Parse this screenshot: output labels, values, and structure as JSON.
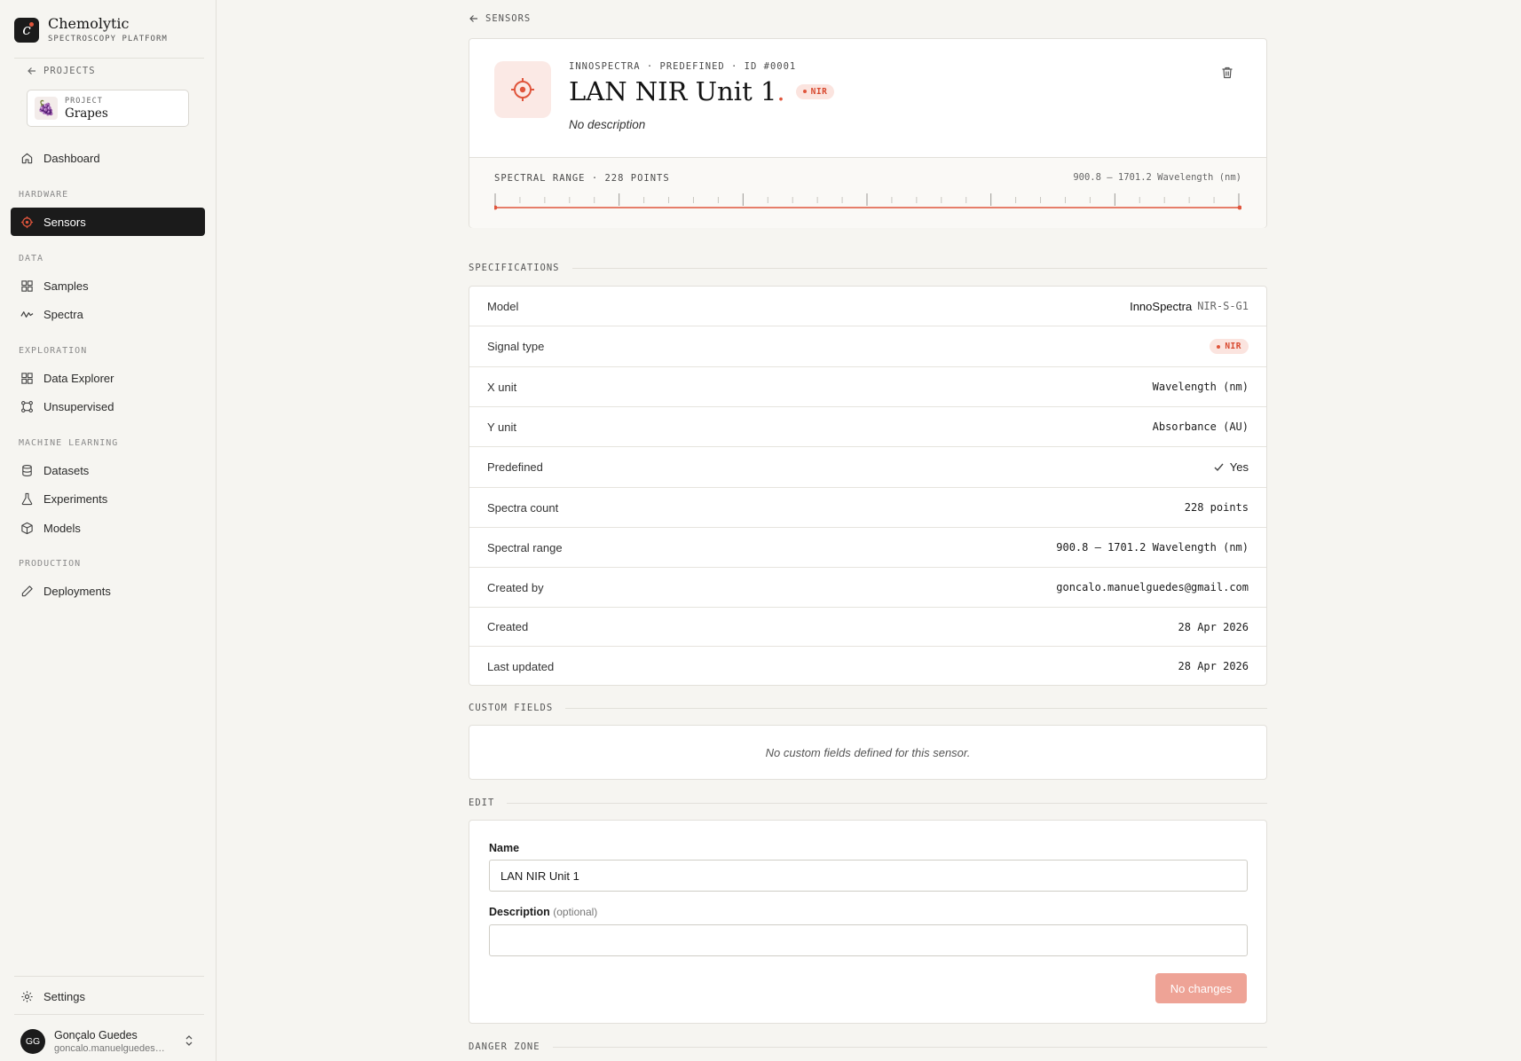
{
  "brand": {
    "name": "Chemolytic",
    "subtitle": "SPECTROSCOPY PLATFORM"
  },
  "sidebar": {
    "back_label": "PROJECTS",
    "project": {
      "label": "PROJECT",
      "name": "Grapes",
      "thumb": "🍇"
    },
    "dashboard": "Dashboard",
    "sections": {
      "hardware": "HARDWARE",
      "data": "DATA",
      "exploration": "EXPLORATION",
      "ml": "MACHINE LEARNING",
      "production": "PRODUCTION"
    },
    "items": {
      "sensors": "Sensors",
      "samples": "Samples",
      "spectra": "Spectra",
      "data_explorer": "Data Explorer",
      "unsupervised": "Unsupervised",
      "datasets": "Datasets",
      "experiments": "Experiments",
      "models": "Models",
      "deployments": "Deployments"
    },
    "settings": "Settings",
    "user": {
      "initials": "GG",
      "name": "Gonçalo Guedes",
      "email": "goncalo.manuelguedes@gmail.com"
    }
  },
  "breadcrumb": {
    "label": "SENSORS"
  },
  "sensor": {
    "meta": "INNOSPECTRA · PREDEFINED · ID #0001",
    "title": "LAN NIR Unit 1",
    "title_accent": ".",
    "badge": "NIR",
    "description": "No description",
    "range_label": "SPECTRAL RANGE · 228 POINTS",
    "range_value": "900.8 – 1701.2 Wavelength (nm)"
  },
  "specifications": {
    "heading": "SPECIFICATIONS",
    "rows": {
      "model": {
        "label": "Model",
        "brand": "InnoSpectra",
        "model": "NIR-S-G1"
      },
      "signal": {
        "label": "Signal type",
        "value": "NIR"
      },
      "xunit": {
        "label": "X unit",
        "value": "Wavelength (nm)"
      },
      "yunit": {
        "label": "Y unit",
        "value": "Absorbance (AU)"
      },
      "predefined": {
        "label": "Predefined",
        "value": "Yes"
      },
      "count": {
        "label": "Spectra count",
        "value": "228 points"
      },
      "range": {
        "label": "Spectral range",
        "value": "900.8 – 1701.2 Wavelength (nm)"
      },
      "created_by": {
        "label": "Created by",
        "value": "goncalo.manuelguedes@gmail.com"
      },
      "created": {
        "label": "Created",
        "value": "28 Apr 2026"
      },
      "updated": {
        "label": "Last updated",
        "value": "28 Apr 2026"
      }
    }
  },
  "custom_fields": {
    "heading": "CUSTOM FIELDS",
    "empty": "No custom fields defined for this sensor."
  },
  "edit": {
    "heading": "EDIT",
    "name_label": "Name",
    "name_value": "LAN NIR Unit 1",
    "desc_label": "Description",
    "desc_optional": "(optional)",
    "desc_value": "",
    "submit_label": "No changes"
  },
  "danger_zone": {
    "heading": "DANGER ZONE"
  },
  "colors": {
    "accent": "#e0553c",
    "dark": "#1b1b1b",
    "background": "#f6f5f1"
  }
}
